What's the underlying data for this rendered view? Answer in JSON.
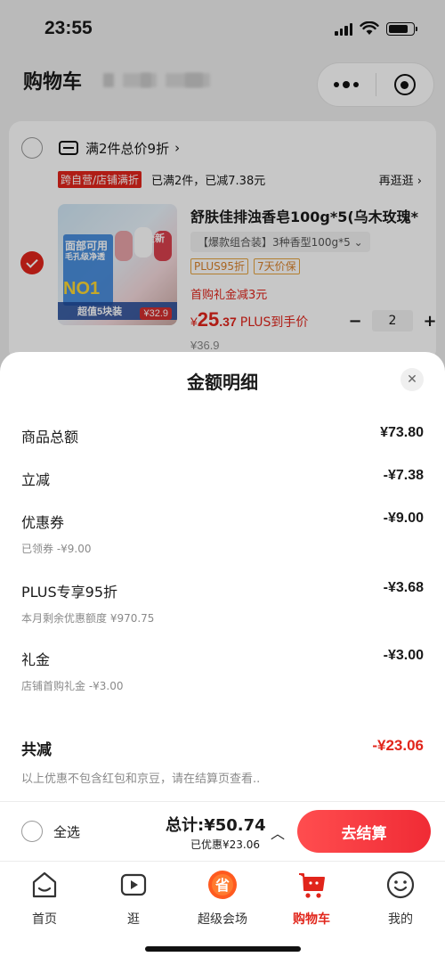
{
  "status_bar": {
    "time": "23:55"
  },
  "nav": {
    "title": "购物车"
  },
  "cart": {
    "promo": {
      "text": "满2件总价9折",
      "chevron": "›"
    },
    "store_tag": "跨自营/店铺满折",
    "store_note": "已满2件，已减7.38元",
    "shop_more": "再逛逛 ›",
    "product": {
      "image_text": {
        "t1": "面部可用",
        "t2": "毛孔级净透",
        "t3": "NO1",
        "t4": "超值5块装",
        "sticker": "¥32.9",
        "badge": "全新"
      },
      "title": "舒肤佳排浊香皂100g*5(乌木玫瑰*",
      "spec": "【爆款组合装】3种香型100g*5 ⌄",
      "tags": [
        "PLUS95折",
        "7天价保"
      ],
      "first_purchase": "首购礼金减3元",
      "price_currency": "¥",
      "price_int": "25",
      "price_dec": ".37",
      "price_suffix": "PLUS到手价",
      "original_price": "¥36.9",
      "quantity": "2",
      "minus": "−",
      "plus": "+"
    }
  },
  "sheet": {
    "title": "金额明细",
    "close": "✕",
    "rows": [
      {
        "label": "商品总额",
        "amount": "¥73.80",
        "sub": ""
      },
      {
        "label": "立减",
        "amount": "-¥7.38",
        "sub": ""
      },
      {
        "label": "优惠券",
        "amount": "-¥9.00",
        "sub": "已领券 -¥9.00"
      },
      {
        "label": "PLUS专享95折",
        "amount": "-¥3.68",
        "sub": "本月剩余优惠额度 ¥970.75"
      },
      {
        "label": "礼金",
        "amount": "-¥3.00",
        "sub": "店铺首购礼金 -¥3.00"
      }
    ],
    "total": {
      "label": "共减",
      "amount": "-¥23.06"
    },
    "note": "以上优惠不包含红包和京豆，请在结算页查看.."
  },
  "bottom_bar": {
    "select_all": "全选",
    "total": "总计:¥50.74",
    "saved": "已优惠¥23.06",
    "chevron": "︿",
    "checkout": "去结算"
  },
  "tabbar": {
    "items": [
      {
        "label": "首页",
        "icon": "home-icon"
      },
      {
        "label": "逛",
        "icon": "play-icon"
      },
      {
        "label": "超级会场",
        "icon": "super-venue-icon"
      },
      {
        "label": "购物车",
        "icon": "cart-icon"
      },
      {
        "label": "我的",
        "icon": "smile-icon"
      }
    ],
    "super_icon_char": "省"
  },
  "colors": {
    "accent": "#e1251b",
    "checkout_from": "#ff4d4f",
    "checkout_to": "#f02b35"
  }
}
